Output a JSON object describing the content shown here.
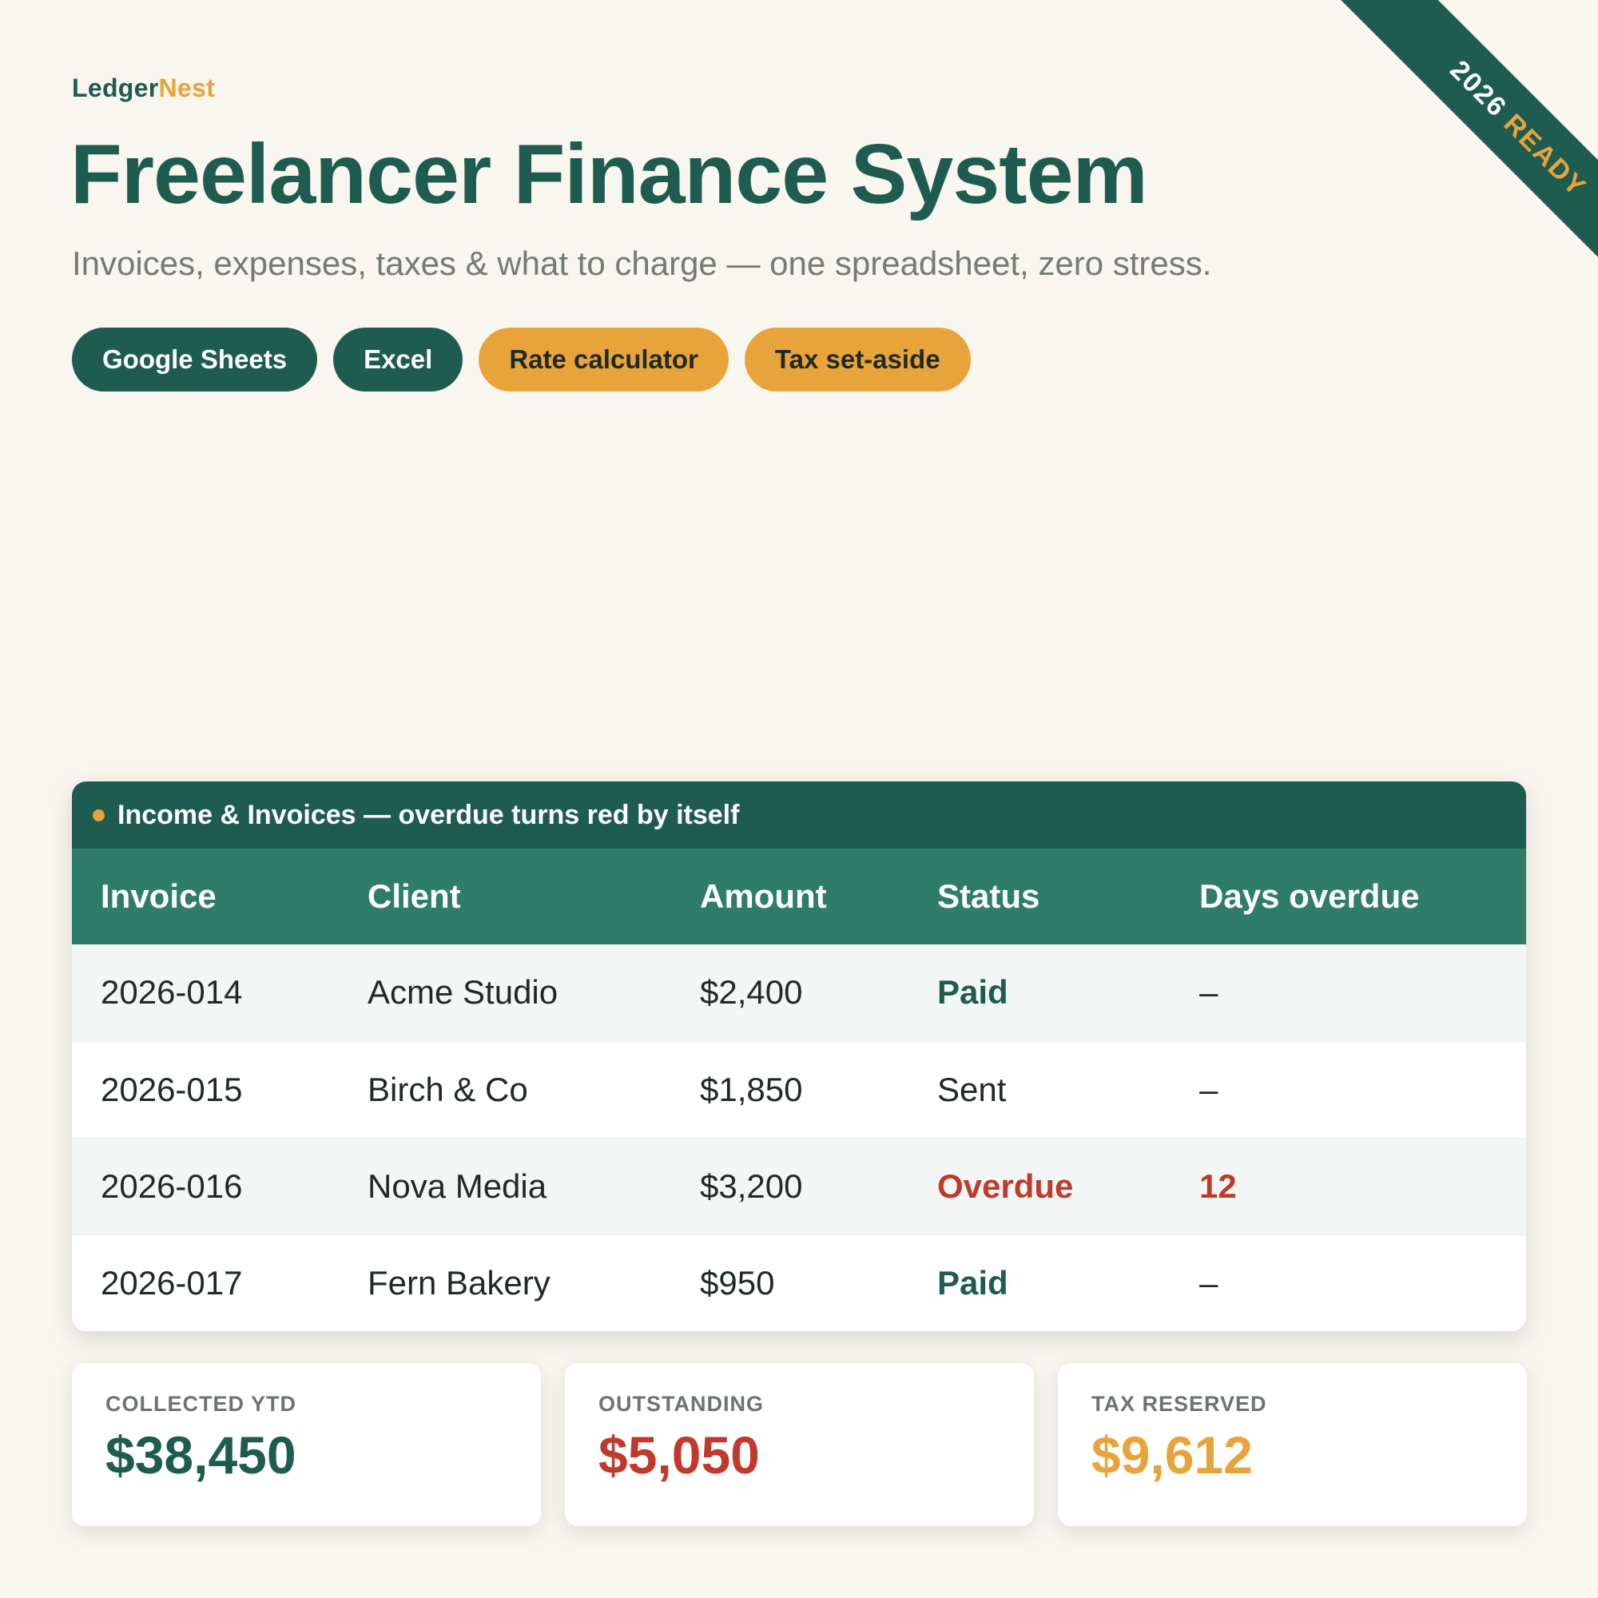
{
  "brand": {
    "part1": "Ledger",
    "part2": "Nest"
  },
  "title": "Freelancer Finance System",
  "subtitle": "Invoices, expenses, taxes & what to charge — one spreadsheet, zero stress.",
  "tags": [
    "Google Sheets",
    "Excel",
    "Rate calculator",
    "Tax set-aside"
  ],
  "ribbon": {
    "year": "2026",
    "word": "READY"
  },
  "table": {
    "caption": "Income & Invoices — overdue turns red by itself",
    "headers": [
      "Invoice",
      "Client",
      "Amount",
      "Status",
      "Days overdue"
    ],
    "rows": [
      {
        "invoice": "2026-014",
        "client": "Acme Studio",
        "amount": "$2,400",
        "status": "Paid",
        "days": "–"
      },
      {
        "invoice": "2026-015",
        "client": "Birch & Co",
        "amount": "$1,850",
        "status": "Sent",
        "days": "–"
      },
      {
        "invoice": "2026-016",
        "client": "Nova Media",
        "amount": "$3,200",
        "status": "Overdue",
        "days": "12"
      },
      {
        "invoice": "2026-017",
        "client": "Fern Bakery",
        "amount": "$950",
        "status": "Paid",
        "days": "–"
      }
    ]
  },
  "stats": [
    {
      "label": "COLLECTED YTD",
      "value": "$38,450"
    },
    {
      "label": "OUTSTANDING",
      "value": "$5,050"
    },
    {
      "label": "TAX RESERVED",
      "value": "$9,612"
    }
  ],
  "colors": {
    "primary": "#1e5c4f",
    "accent": "#e8a43a",
    "danger": "#c0392b",
    "header_teal": "#2e7d69",
    "background": "#f9f5ef"
  }
}
